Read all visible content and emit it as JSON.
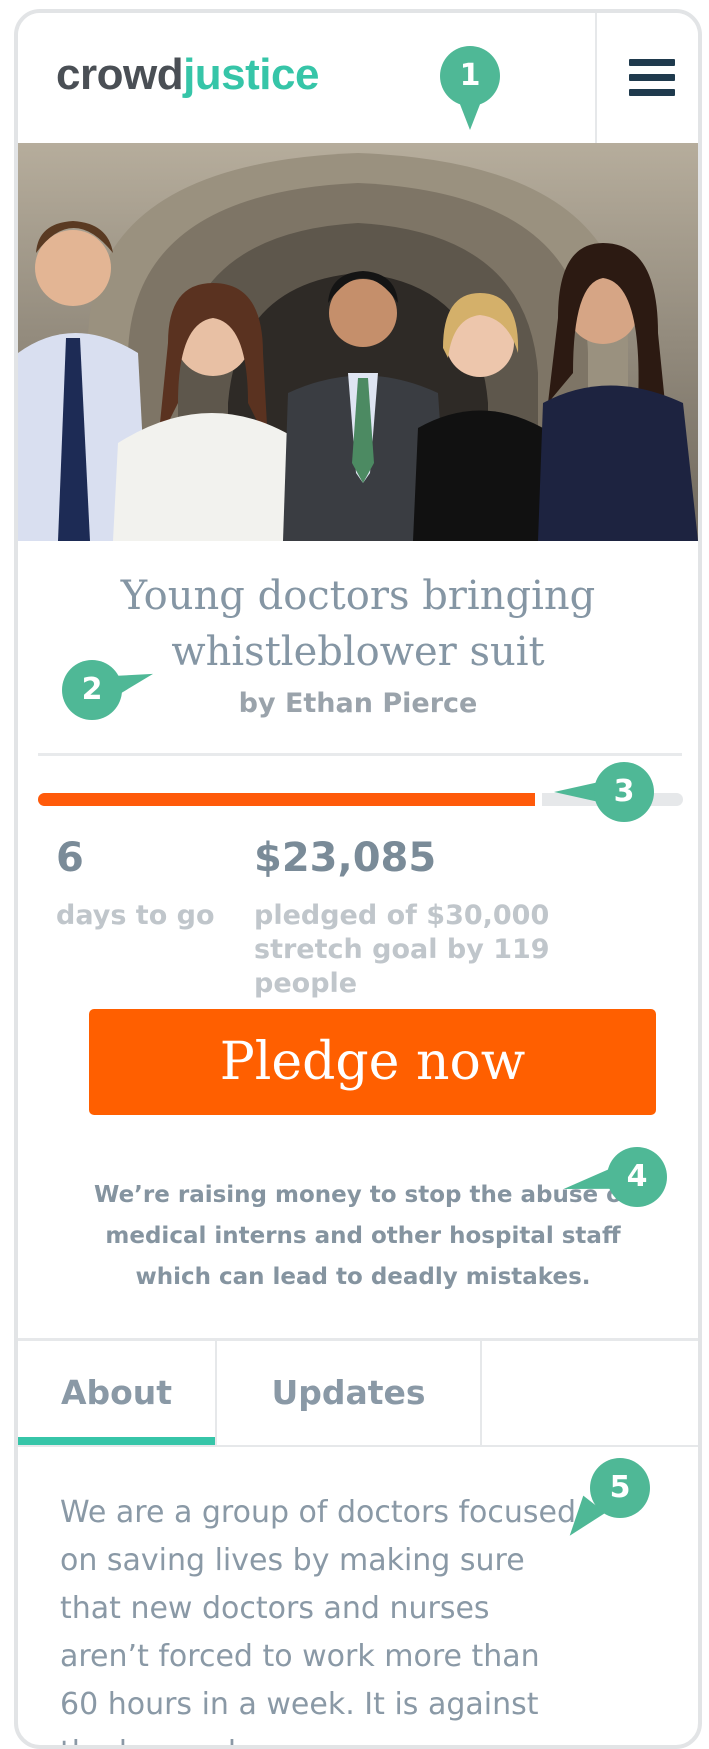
{
  "brand": {
    "part1": "crowd",
    "part2": "justice",
    "accent": "#36c5a8",
    "dark": "#4a4f55"
  },
  "header": {
    "menu_icon": "hamburger-menu-icon"
  },
  "campaign": {
    "title": "Young doctors bringing whistleblower suit",
    "author": "by Ethan Pierce",
    "progress_fraction": 0.77,
    "days_value": "6",
    "days_label": "days to go",
    "amount_value": "$23,085",
    "amount_label": "pledged of $30,000 stretch goal by 119 people",
    "cta_label": "Pledge now",
    "cta_color": "#ff5f00",
    "description": "We’re raising money to stop the abuse of medical interns and other hospital staff which can lead to deadly mistakes."
  },
  "tabs": [
    {
      "label": "About",
      "active": true
    },
    {
      "label": "Updates",
      "active": false
    }
  ],
  "about": {
    "body": "We are a group of doctors focused on saving lives by making sure that new doctors and nurses aren’t forced to work more than 60 hours in a week. It is against the law and"
  },
  "callouts": [
    "1",
    "2",
    "3",
    "4",
    "5"
  ],
  "callout_color": "#4fb896"
}
